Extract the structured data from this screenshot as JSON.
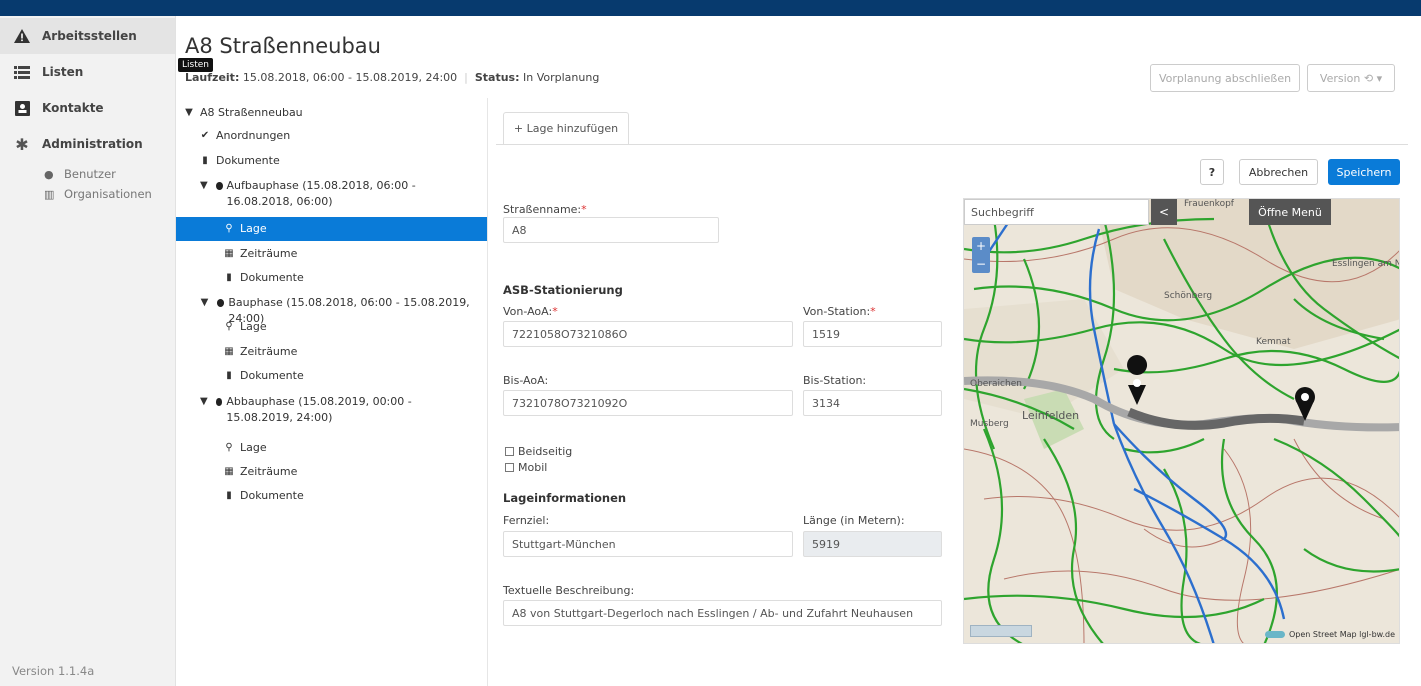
{
  "sidebar": {
    "items": [
      {
        "label": "Arbeitsstellen",
        "icon": "warning-icon"
      },
      {
        "label": "Listen",
        "icon": "list-icon"
      },
      {
        "label": "Kontakte",
        "icon": "contact-card-icon"
      },
      {
        "label": "Administration",
        "icon": "gear-icon"
      }
    ],
    "subitems": [
      {
        "label": "Benutzer",
        "icon": "user-icon"
      },
      {
        "label": "Organisationen",
        "icon": "building-icon"
      }
    ],
    "version": "Version 1.1.4a",
    "tooltip": "Listen"
  },
  "header": {
    "title": "A8 Straßenneubau",
    "laufzeit_label": "Laufzeit:",
    "laufzeit_value": "15.08.2018, 06:00 - 15.08.2019, 24:00",
    "status_label": "Status:",
    "status_value": "In Vorplanung",
    "btn_vorplanung": "Vorplanung abschließen",
    "btn_version": "Version ⟲ ▾"
  },
  "tree": [
    {
      "label": "A8 Straßenneubau",
      "icon": "chevron-down-icon"
    },
    {
      "label": "Anordnungen",
      "icon": "check-circle-icon"
    },
    {
      "label": "Dokumente",
      "icon": "file-icon"
    },
    {
      "label": "Aufbauphase (15.08.2018, 06:00 - 16.08.2018, 06:00)",
      "icon": "chevron-down-icon"
    },
    {
      "label": "Lage",
      "icon": "map-marker-icon"
    },
    {
      "label": "Zeiträume",
      "icon": "calendar-icon"
    },
    {
      "label": "Dokumente",
      "icon": "file-icon"
    },
    {
      "label": "Bauphase (15.08.2018, 06:00 - 15.08.2019, 24:00)",
      "icon": "chevron-down-icon"
    },
    {
      "label": "Lage",
      "icon": "map-marker-icon"
    },
    {
      "label": "Zeiträume",
      "icon": "calendar-icon"
    },
    {
      "label": "Dokumente",
      "icon": "file-icon"
    },
    {
      "label": "Abbauphase (15.08.2019, 00:00 - 15.08.2019, 24:00)",
      "icon": "chevron-down-icon"
    },
    {
      "label": "Lage",
      "icon": "map-marker-icon"
    },
    {
      "label": "Zeiträume",
      "icon": "calendar-icon"
    },
    {
      "label": "Dokumente",
      "icon": "file-icon"
    }
  ],
  "form": {
    "tab_label": "+ Lage hinzufügen",
    "help_label": "?",
    "cancel_label": "Abbrechen",
    "save_label": "Speichern",
    "strassenname_label": "Straßenname:",
    "strassenname_value": "A8",
    "asb_title": "ASB-Stationierung",
    "von_aoa_label": "Von-AoA:",
    "von_aoa_value": "7221058O7321086O",
    "von_station_label": "Von-Station:",
    "von_station_value": "1519",
    "bis_aoa_label": "Bis-AoA:",
    "bis_aoa_value": "7321078O7321092O",
    "bis_station_label": "Bis-Station:",
    "bis_station_value": "3134",
    "beidseitig_label": "Beidseitig",
    "mobil_label": "Mobil",
    "lageinfo_title": "Lageinformationen",
    "fernziel_label": "Fernziel:",
    "fernziel_value": "Stuttgart-München",
    "laenge_label": "Länge (in Metern):",
    "laenge_value": "5919",
    "beschreibung_label": "Textuelle Beschreibung:",
    "beschreibung_value": "A8 von Stuttgart-Degerloch nach Esslingen / Ab- und Zufahrt Neuhausen",
    "required_mark": "*"
  },
  "map": {
    "search_placeholder": "Suchbegriff",
    "back_label": "<",
    "menu_label": "Öffne Menü",
    "attribution": "Open Street Map lgl-bw.de",
    "places": [
      "Frauenkopf",
      "Leinfelden",
      "Musberg",
      "Oberaichen",
      "Schönberg",
      "Kemnat",
      "Esslingen am N"
    ]
  }
}
